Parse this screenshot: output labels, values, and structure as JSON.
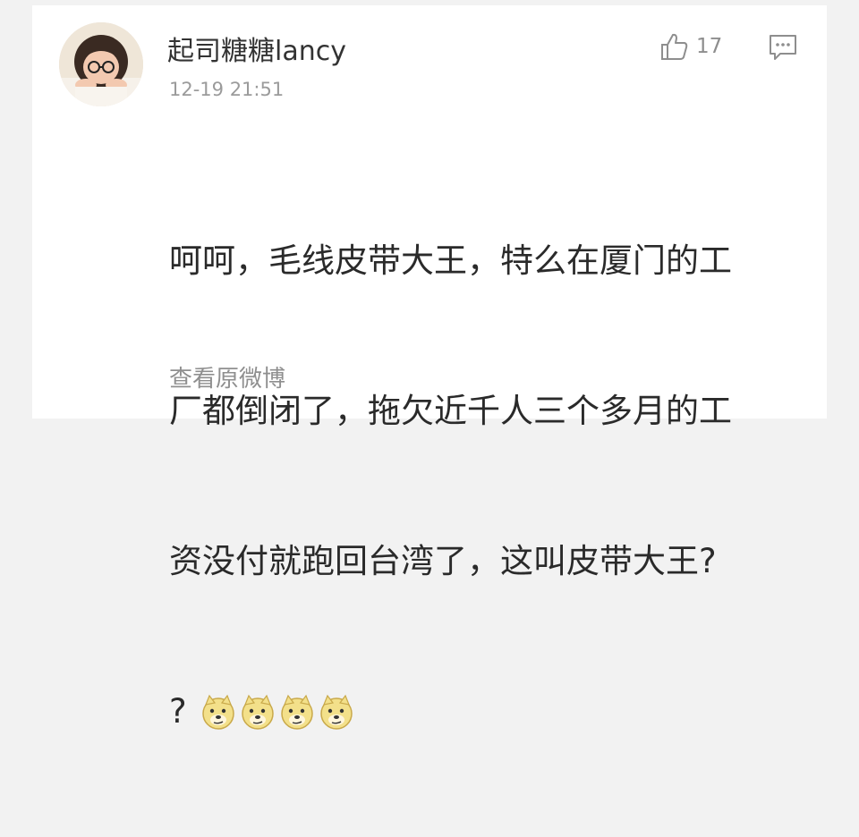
{
  "comment": {
    "username": "起司糖糖lancy",
    "timestamp": "12-19 21:51",
    "like_count": "17",
    "text_lines": [
      "呵呵，毛线皮带大王，特么在厦门的工",
      "厂都倒闭了，拖欠近千人三个多月的工",
      "资没付就跑回台湾了，这叫皮带大王?"
    ],
    "last_line_text": "?",
    "emojis": [
      "doge-emoji",
      "doge-emoji",
      "doge-emoji",
      "doge-emoji"
    ],
    "view_original_label": "查看原微博"
  },
  "icons": {
    "like": "thumbs-up-icon",
    "reply": "comment-icon"
  },
  "colors": {
    "background": "#f2f2f2",
    "card": "#ffffff",
    "text": "#2a2a2a",
    "muted": "#9b9b9b"
  }
}
